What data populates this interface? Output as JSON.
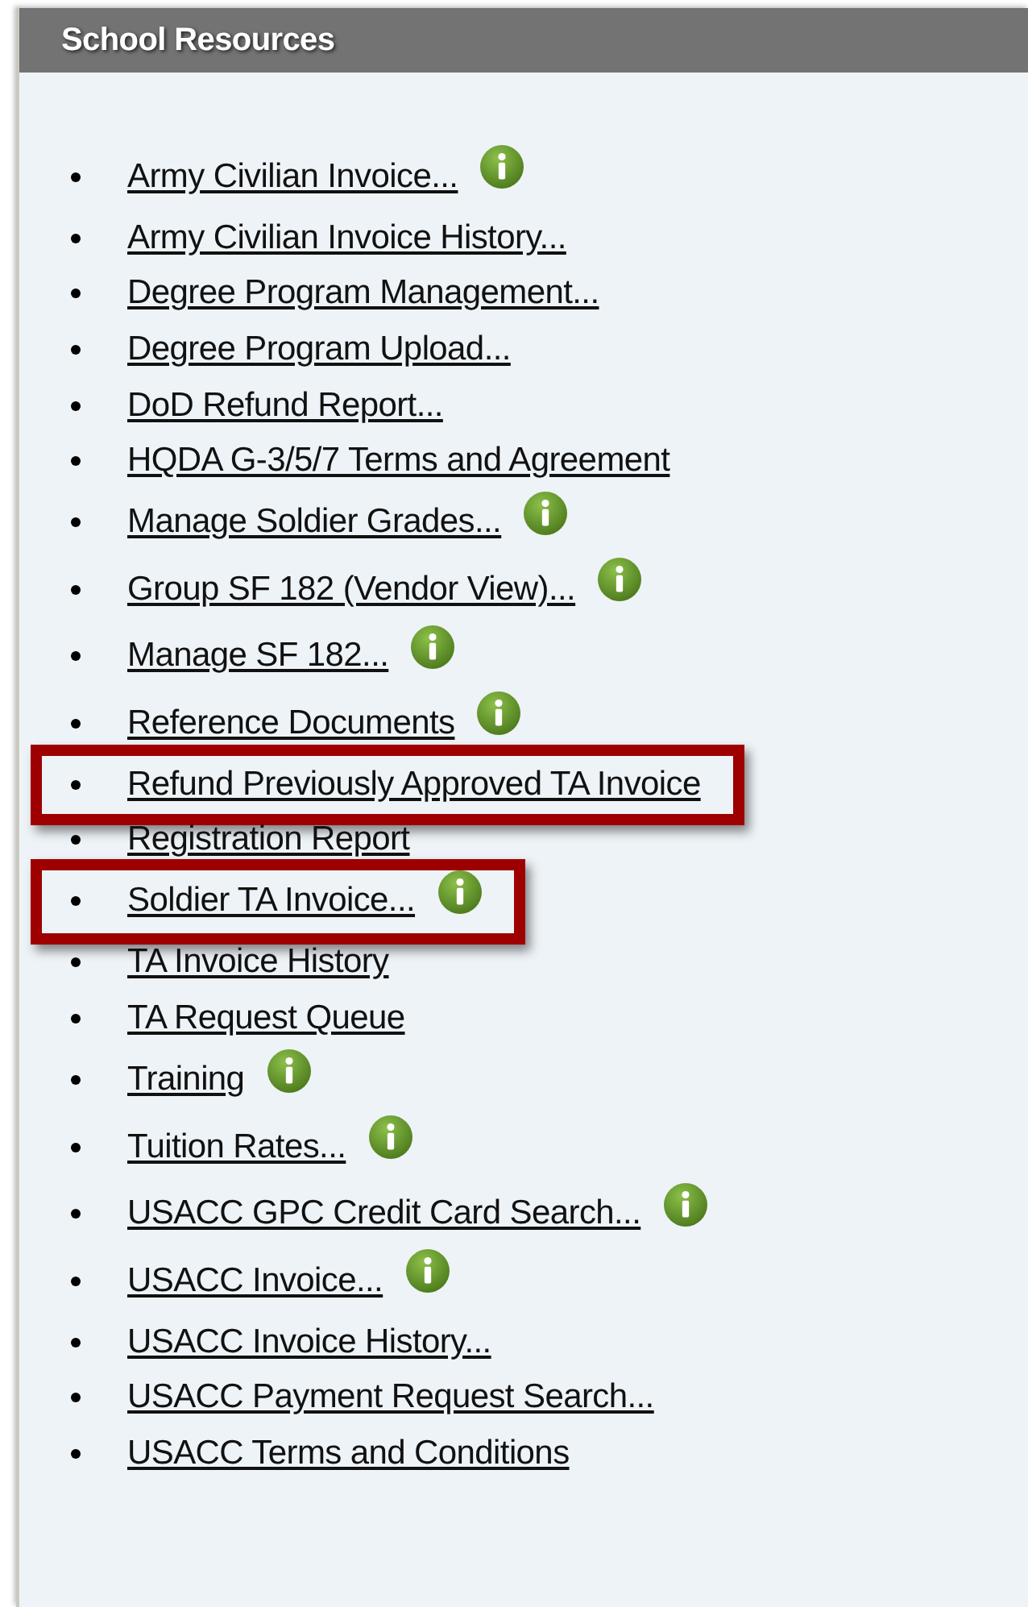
{
  "panel": {
    "title": "School Resources"
  },
  "links": [
    {
      "label": "Army Civilian Invoice...",
      "info": true,
      "highlighted": false
    },
    {
      "label": "Army Civilian Invoice History...",
      "info": false,
      "highlighted": false
    },
    {
      "label": "Degree Program Management...",
      "info": false,
      "highlighted": false
    },
    {
      "label": "Degree Program Upload...",
      "info": false,
      "highlighted": false
    },
    {
      "label": "DoD Refund Report...",
      "info": false,
      "highlighted": false
    },
    {
      "label": "HQDA G-3/5/7 Terms and Agreement",
      "info": false,
      "highlighted": false
    },
    {
      "label": "Manage Soldier Grades...",
      "info": true,
      "highlighted": false
    },
    {
      "label": "Group SF 182 (Vendor View)...",
      "info": true,
      "highlighted": false
    },
    {
      "label": "Manage SF 182...",
      "info": true,
      "highlighted": false
    },
    {
      "label": "Reference Documents",
      "info": true,
      "highlighted": false
    },
    {
      "label": "Refund Previously Approved TA Invoice",
      "info": false,
      "highlighted": true
    },
    {
      "label": "Registration Report",
      "info": false,
      "highlighted": false
    },
    {
      "label": "Soldier TA Invoice...",
      "info": true,
      "highlighted": true
    },
    {
      "label": "TA Invoice History",
      "info": false,
      "highlighted": false
    },
    {
      "label": "TA Request Queue",
      "info": false,
      "highlighted": false
    },
    {
      "label": "Training",
      "info": true,
      "highlighted": false
    },
    {
      "label": "Tuition Rates...",
      "info": true,
      "highlighted": false
    },
    {
      "label": "USACC GPC Credit Card Search...",
      "info": true,
      "highlighted": false
    },
    {
      "label": "USACC Invoice...",
      "info": true,
      "highlighted": false
    },
    {
      "label": "USACC Invoice History...",
      "info": false,
      "highlighted": false
    },
    {
      "label": "USACC Payment Request Search...",
      "info": false,
      "highlighted": false
    },
    {
      "label": "USACC Terms and Conditions",
      "info": false,
      "highlighted": false
    }
  ]
}
